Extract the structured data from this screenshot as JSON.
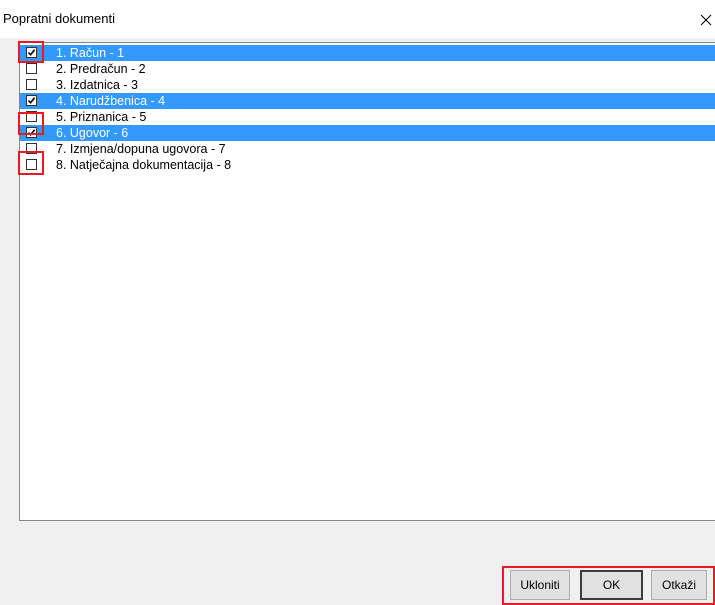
{
  "dialog": {
    "title": "Popratni dokumenti",
    "close_icon": "close-icon"
  },
  "list": {
    "items": [
      {
        "label": "1. Račun - 1",
        "checked": true,
        "selected": true
      },
      {
        "label": "2. Predračun - 2",
        "checked": false,
        "selected": false
      },
      {
        "label": "3. Izdatnica - 3",
        "checked": false,
        "selected": false
      },
      {
        "label": "4. Narudžbenica - 4",
        "checked": true,
        "selected": true
      },
      {
        "label": "5. Priznanica - 5",
        "checked": false,
        "selected": false
      },
      {
        "label": "6. Ugovor - 6",
        "checked": true,
        "selected": true
      },
      {
        "label": "7. Izmjena/dopuna ugovora - 7",
        "checked": false,
        "selected": false
      },
      {
        "label": "8. Natječajna dokumentacija - 8",
        "checked": false,
        "selected": false
      }
    ]
  },
  "buttons": {
    "remove_label": "Ukloniti",
    "ok_label": "OK",
    "cancel_label": "Otkaži"
  },
  "colors": {
    "selection": "#3399ff",
    "annotation": "#e81b23",
    "dialog_bg": "#f0f0f0"
  }
}
